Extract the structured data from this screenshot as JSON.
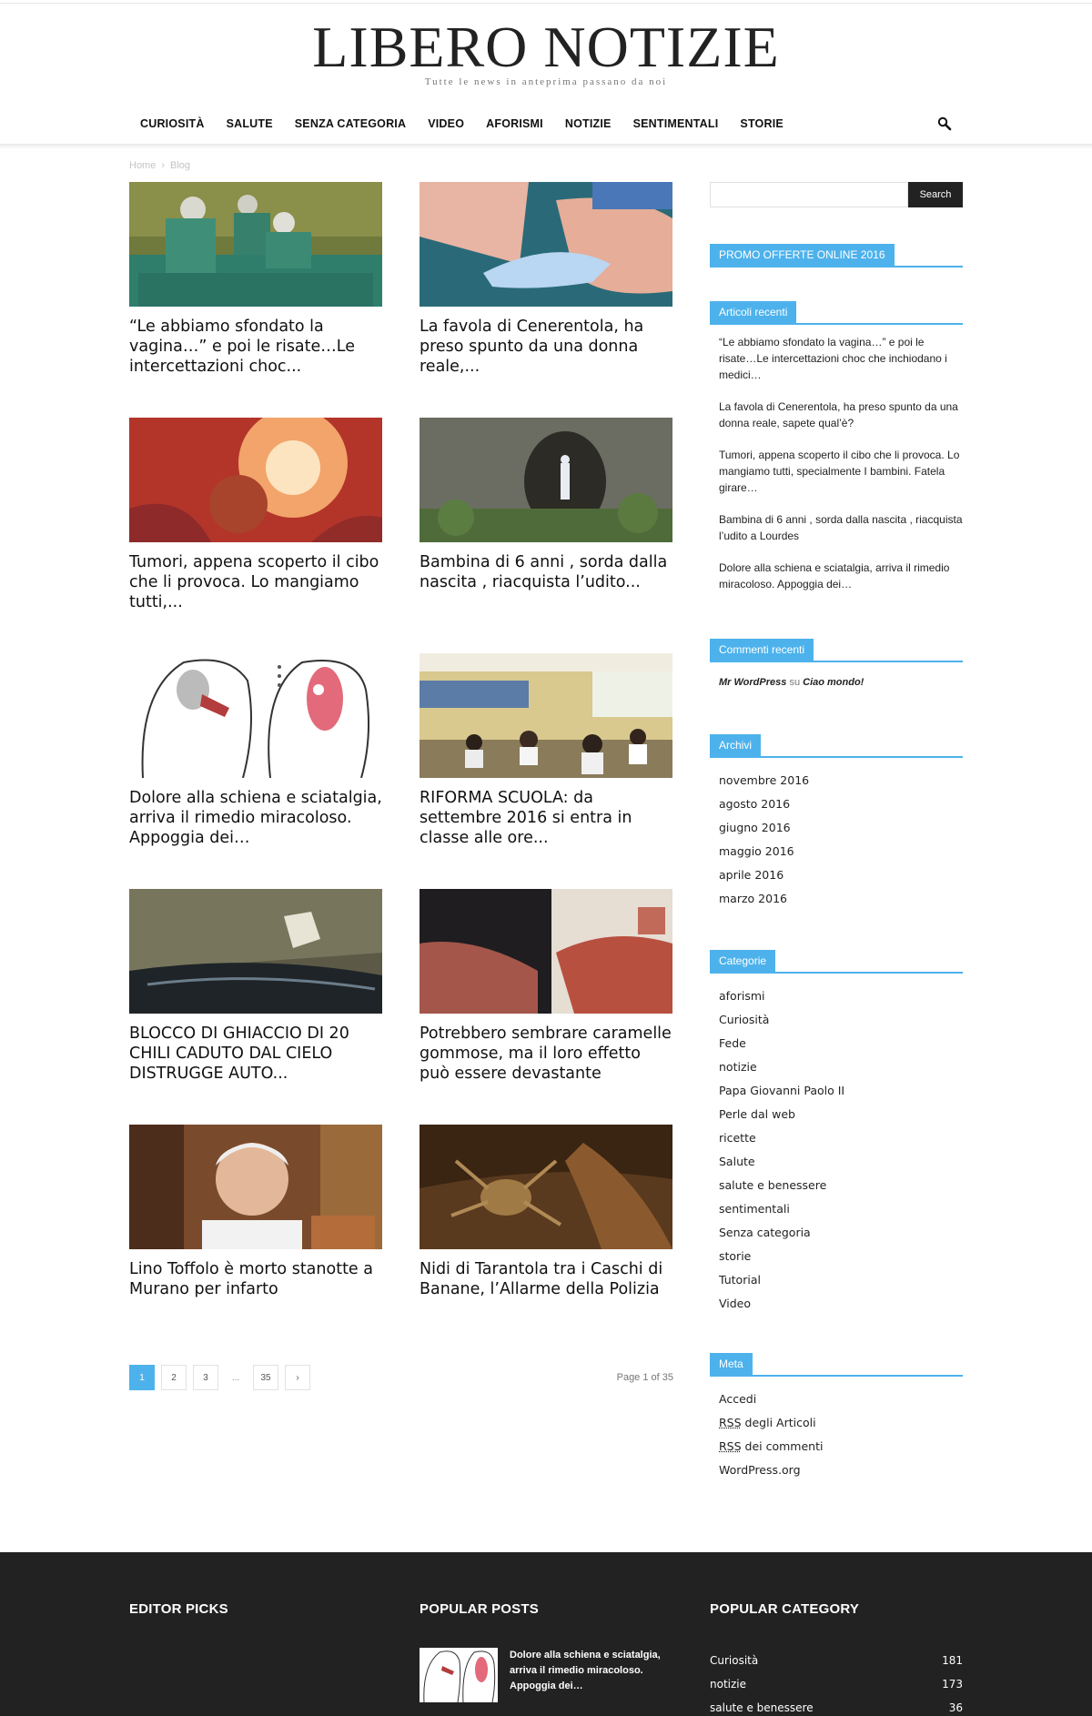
{
  "site": {
    "title": "LIBERO NOTIZIE",
    "tagline": "Tutte le news in anteprima passano da noi"
  },
  "menu": [
    "CURIOSITÀ",
    "SALUTE",
    "SENZA CATEGORIA",
    "VIDEO",
    "AFORISMI",
    "NOTIZIE",
    "SENTIMENTALI",
    "STORIE"
  ],
  "breadcrumb": {
    "home": "Home",
    "sep": "›",
    "current": "Blog"
  },
  "posts": [
    {
      "title": "“Le abbiamo sfondato la vagina…” e poi le risate…Le intercettazioni choc...",
      "image": "surgery-photo"
    },
    {
      "title": "La favola di Cenerentola, ha preso spunto da una donna reale,...",
      "image": "cinderella-shoe"
    },
    {
      "title": "Tumori, appena scoperto il cibo che li provoca. Lo mangiamo tutti,...",
      "image": "tumor-illustration"
    },
    {
      "title": "Bambina di 6 anni , sorda dalla nascita , riacquista l’udito...",
      "image": "lourdes-grotto"
    },
    {
      "title": "Dolore alla schiena e sciatalgia, arriva il rimedio miracoloso. Appoggia dei…",
      "image": "sciatica-diagram"
    },
    {
      "title": "RIFORMA SCUOLA: da settembre 2016 si entra in classe alle ore...",
      "image": "classroom-photo"
    },
    {
      "title": "BLOCCO DI GHIACCIO DI 20 CHILI CADUTO DAL CIELO DISTRUGGE AUTO...",
      "image": "broken-car"
    },
    {
      "title": "Potrebbero sembrare caramelle gommose, ma il loro effetto può essere devastante",
      "image": "skin-condition"
    },
    {
      "title": "Lino Toffolo è morto stanotte a Murano per infarto",
      "image": "portrait-man"
    },
    {
      "title": "Nidi di Tarantola tra i Caschi di Banane, l’Allarme della Polizia",
      "image": "tarantula"
    }
  ],
  "pagination": {
    "pages": [
      "1",
      "2",
      "3"
    ],
    "dots": "...",
    "last": "35",
    "next": "›",
    "info": "Page 1 of 35"
  },
  "sidebar": {
    "search_button": "Search",
    "promo_title": "PROMO OFFERTE ONLINE 2016",
    "recent_title": "Articoli recenti",
    "recent": [
      "“Le abbiamo sfondato la vagina…” e poi le risate…Le intercettazioni choc che inchiodano i medici…",
      "La favola di Cenerentola, ha preso spunto da una donna reale, sapete qual’è?",
      "Tumori, appena scoperto il cibo che li provoca. Lo mangiamo tutti, specialmente I bambini. Fatela girare…",
      "Bambina di 6 anni , sorda dalla nascita , riacquista l’udito a Lourdes",
      "Dolore alla schiena e sciatalgia, arriva il rimedio miracoloso. Appoggia dei…"
    ],
    "comments_title": "Commenti recenti",
    "comment": {
      "author": "Mr WordPress",
      "on": "su",
      "post": "Ciao mondo!"
    },
    "archives_title": "Archivi",
    "archives": [
      "novembre 2016",
      "agosto 2016",
      "giugno 2016",
      "maggio 2016",
      "aprile 2016",
      "marzo 2016"
    ],
    "categories_title": "Categorie",
    "categories": [
      "aforismi",
      "Curiosità",
      "Fede",
      "notizie",
      "Papa Giovanni Paolo II",
      "Perle dal web",
      "ricette",
      "Salute",
      "salute e benessere",
      "sentimentali",
      "Senza categoria",
      "storie",
      "Tutorial",
      "Video"
    ],
    "meta_title": "Meta",
    "meta": {
      "login": "Accedi",
      "rss": "RSS",
      "rss_posts": " degli Articoli",
      "rss_comments": " dei commenti",
      "wp": "WordPress.org"
    }
  },
  "footer": {
    "editor_picks": "EDITOR PICKS",
    "popular_posts": "POPULAR POSTS",
    "popular_category": "POPULAR CATEGORY",
    "popular_post_title": "Dolore alla schiena e sciatalgia, arriva il rimedio miracoloso. Appoggia dei…",
    "popular_categories": [
      {
        "name": "Curiosità",
        "count": "181"
      },
      {
        "name": "notizie",
        "count": "173"
      },
      {
        "name": "salute e benessere",
        "count": "36"
      }
    ]
  }
}
